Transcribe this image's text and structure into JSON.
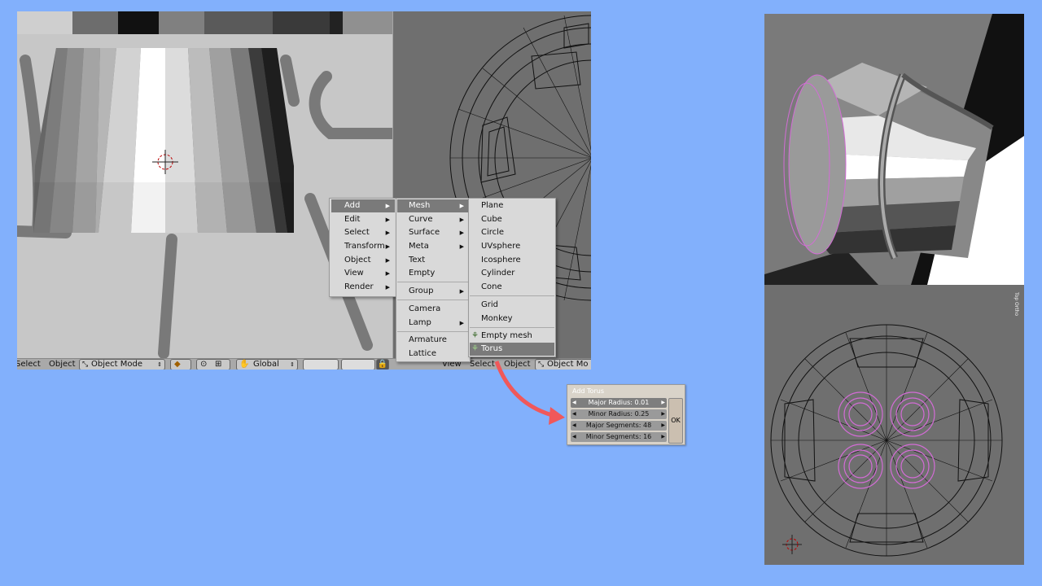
{
  "header": {
    "select": "Select",
    "object": "Object",
    "mode": "Object Mode",
    "orientation": "Global",
    "view": "View",
    "select2": "Select",
    "object2": "Object",
    "mode2": "Object Mo"
  },
  "main_menu": {
    "items": [
      {
        "label": "Add"
      },
      {
        "label": "Edit"
      },
      {
        "label": "Select"
      },
      {
        "label": "Transform"
      },
      {
        "label": "Object"
      },
      {
        "label": "View"
      },
      {
        "label": "Render"
      }
    ]
  },
  "add_menu": {
    "items": [
      {
        "label": "Mesh"
      },
      {
        "label": "Curve"
      },
      {
        "label": "Surface"
      },
      {
        "label": "Meta"
      },
      {
        "label": "Text"
      },
      {
        "label": "Empty"
      },
      {
        "label": "Group"
      },
      {
        "label": "Camera"
      },
      {
        "label": "Lamp"
      },
      {
        "label": "Armature"
      },
      {
        "label": "Lattice"
      }
    ]
  },
  "mesh_menu": {
    "items": [
      {
        "label": "Plane"
      },
      {
        "label": "Cube"
      },
      {
        "label": "Circle"
      },
      {
        "label": "UVsphere"
      },
      {
        "label": "Icosphere"
      },
      {
        "label": "Cylinder"
      },
      {
        "label": "Cone"
      },
      {
        "label": "Grid"
      },
      {
        "label": "Monkey"
      },
      {
        "label": "Empty mesh"
      },
      {
        "label": "Torus"
      }
    ]
  },
  "dialog": {
    "title": "Add Torus",
    "fields": [
      {
        "label": "Major Radius: 0.01"
      },
      {
        "label": "Minor Radius: 0.25"
      },
      {
        "label": "Major Segments: 48"
      },
      {
        "label": "Minor Segments: 16"
      }
    ],
    "ok": "OK"
  },
  "right_view": {
    "label": "Top Ortho"
  },
  "colors": {
    "background": "#82b0fc",
    "selection": "#d36cd6",
    "arrow": "#f0585a"
  }
}
